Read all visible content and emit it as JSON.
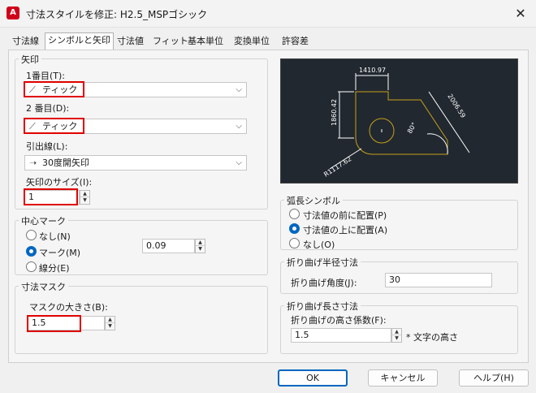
{
  "window": {
    "title": "寸法スタイルを修正: H2.5_MSPゴシック",
    "app_icon_text": "A",
    "close": "✕"
  },
  "tabs": [
    "寸法線",
    "シンボルと矢印",
    "寸法値",
    "フィット",
    "基本単位",
    "変換単位",
    "許容差"
  ],
  "arrows": {
    "title": "矢印",
    "first_label": "1番目(T):",
    "first_value": "ティック",
    "second_label": "2 番目(D):",
    "second_value": "ティック",
    "leader_label": "引出線(L):",
    "leader_value": "30度開矢印",
    "size_label": "矢印のサイズ(I):",
    "size_value": "1"
  },
  "center_mark": {
    "title": "中心マーク",
    "options": [
      "なし(N)",
      "マーク(M)",
      "線分(E)"
    ],
    "selected": 1,
    "size_value": "0.09"
  },
  "dim_mask": {
    "title": "寸法マスク",
    "size_label": "マスクの大きさ(B):",
    "size_value": "1.5"
  },
  "preview": {
    "dims": [
      "1410.97",
      "1860.42",
      "2006.59",
      "80°",
      "R1117.62"
    ]
  },
  "arc_symbol": {
    "title": "弧長シンボル",
    "options": [
      "寸法値の前に配置(P)",
      "寸法値の上に配置(A)",
      "なし(O)"
    ],
    "selected": 1
  },
  "jog_radius": {
    "title": "折り曲げ半径寸法",
    "angle_label": "折り曲げ角度(J):",
    "angle_value": "30"
  },
  "jog_linear": {
    "title": "折り曲げ長さ寸法",
    "factor_label": "折り曲げの高さ係数(F):",
    "factor_value": "1.5",
    "suffix": "* 文字の高さ"
  },
  "buttons": {
    "ok": "OK",
    "cancel": "キャンセル",
    "help": "ヘルプ(H)"
  },
  "colors": {
    "accent": "#0067c0",
    "highlight": "#e00000",
    "preview_bg": "#212830",
    "preview_geom": "#c8a01a"
  }
}
